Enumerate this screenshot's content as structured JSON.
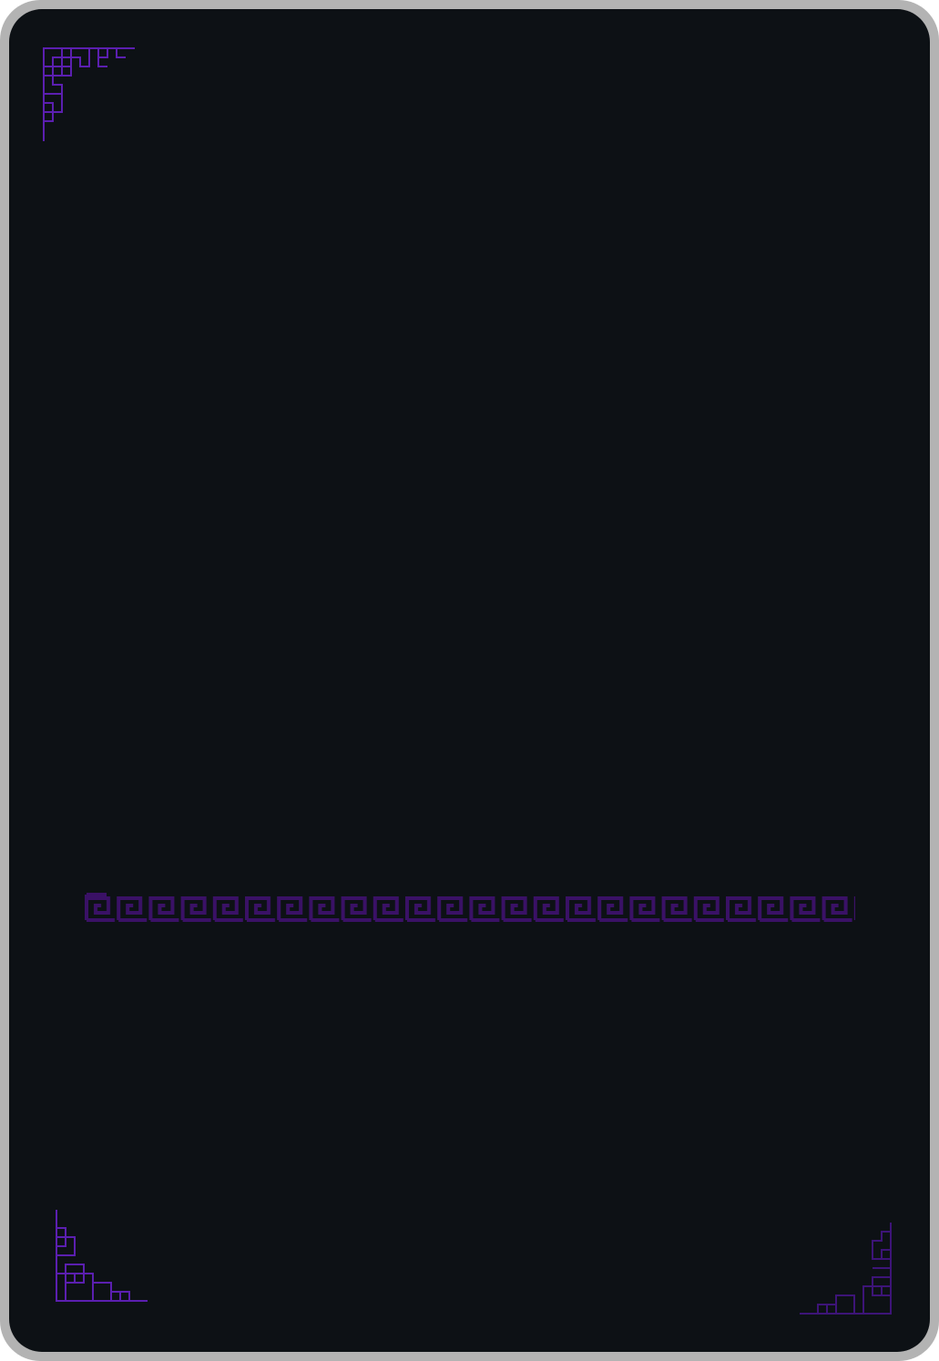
{
  "card": {
    "frame_color": "#b3b3b3",
    "face_color": "#0d1115",
    "ornament_color": "#5b1fb0",
    "ornament_color_dim": "#3d1478",
    "band_color": "#3a1166"
  },
  "icons": {
    "corner_top_left": "greek-key-corner-icon",
    "corner_bottom_left": "greek-key-corner-icon",
    "corner_bottom_right": "greek-key-corner-icon",
    "center_band": "greek-key-meander-band"
  }
}
